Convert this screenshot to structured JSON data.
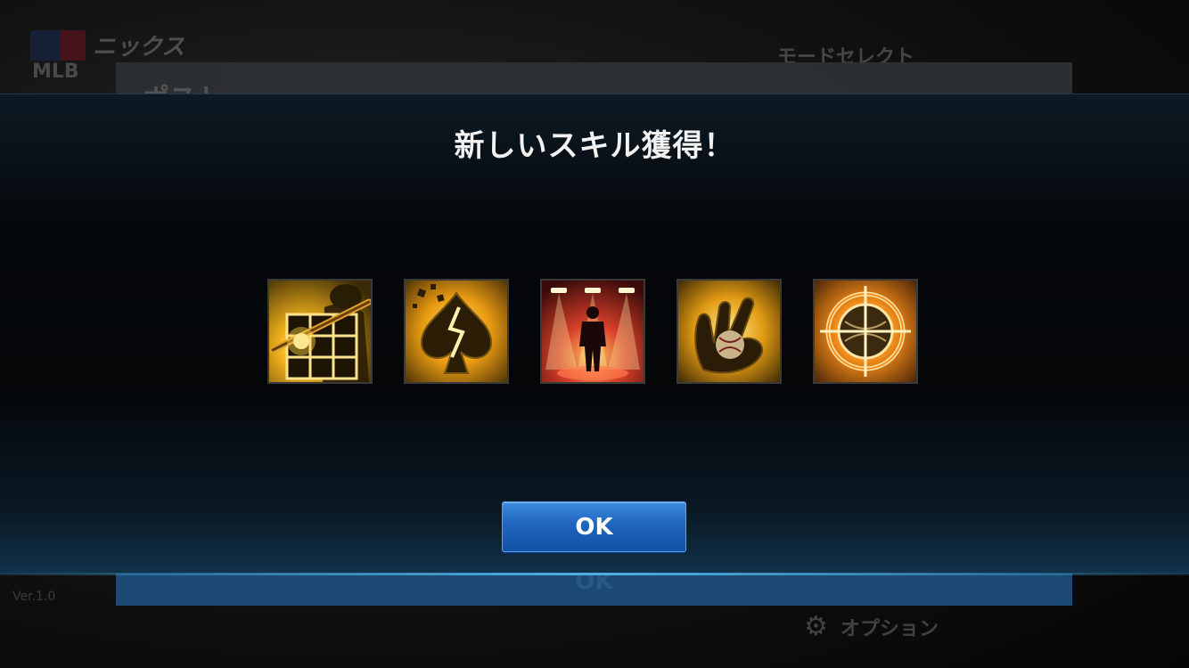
{
  "background": {
    "logo_text": "MLB",
    "game_title": "ニックス",
    "mode_select": "モードセレクト",
    "panel_title": "ポスト",
    "panel_ok": "OK",
    "option_label": "オプション",
    "footer_small": "Ver.1.0"
  },
  "modal": {
    "title": "新しいスキル獲得！",
    "ok_label": "OK"
  },
  "skills": [
    {
      "icon": "batter-grid-skill-icon"
    },
    {
      "icon": "broken-spade-skill-icon"
    },
    {
      "icon": "stage-spotlight-skill-icon"
    },
    {
      "icon": "fork-ball-grip-skill-icon"
    },
    {
      "icon": "target-baseball-skill-icon"
    }
  ],
  "colors": {
    "accent_blue": "#1f64be",
    "skill_gold": "#f2b01e"
  }
}
